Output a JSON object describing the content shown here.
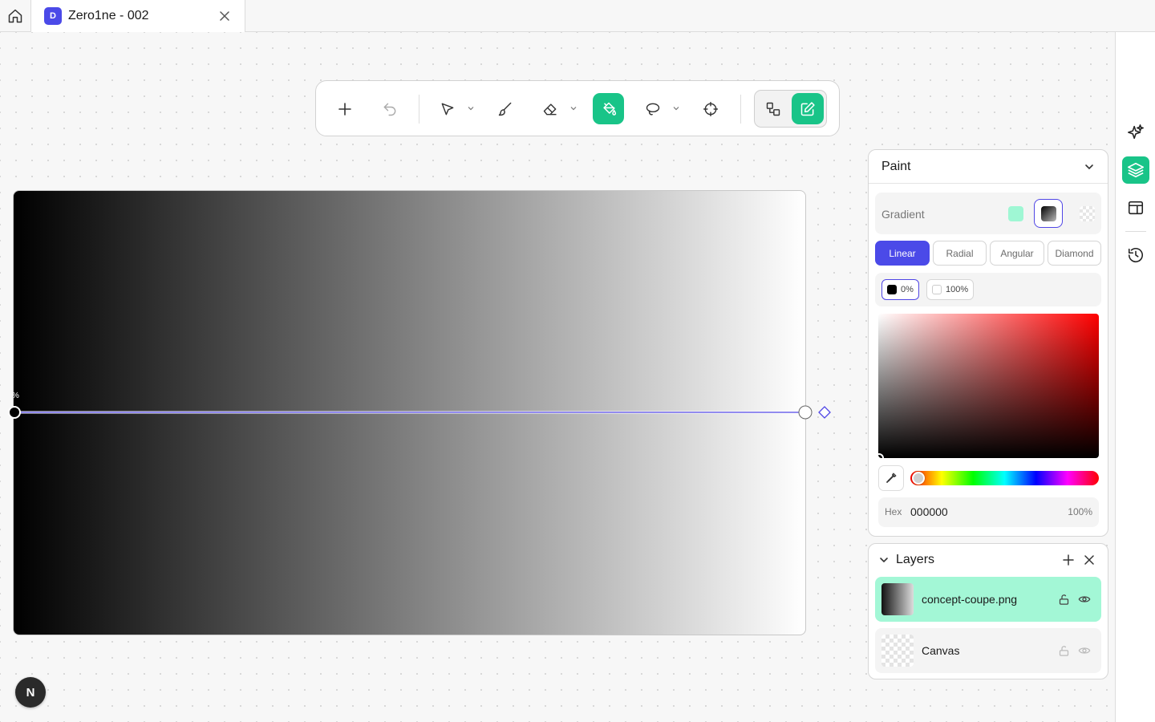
{
  "tab": {
    "badge": "D",
    "title": "Zero1ne - 002"
  },
  "toolbar": {
    "tools": [
      "add-icon",
      "undo-icon",
      "pointer-icon",
      "brush-icon",
      "eraser-icon",
      "paint-bucket-icon",
      "lasso-icon",
      "crosshair-icon",
      "shapes-icon",
      "edit-icon"
    ],
    "active_tool": "paint-bucket-icon",
    "accent_color": "#19c488"
  },
  "canvas": {
    "gradient_from": "#000000",
    "gradient_to": "#ffffff",
    "handle_label": "%"
  },
  "paint_panel": {
    "title": "Paint",
    "fill_label": "Gradient",
    "types": [
      "Linear",
      "Radial",
      "Angular",
      "Diamond"
    ],
    "active_type": "Linear",
    "stops": [
      {
        "label": "0%",
        "color": "#000000"
      },
      {
        "label": "100%",
        "color": "#ffffff"
      }
    ],
    "hex_label": "Hex",
    "hex_value": "000000",
    "alpha": "100%"
  },
  "layers_panel": {
    "title": "Layers",
    "layers": [
      {
        "name": "concept-coupe.png",
        "selected": true
      },
      {
        "name": "Canvas",
        "selected": false
      }
    ]
  },
  "avatar": {
    "initial": "N"
  }
}
